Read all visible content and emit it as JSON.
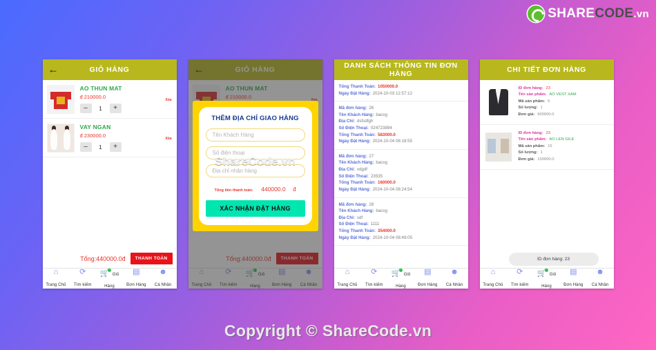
{
  "brand": {
    "part1": "SHARE",
    "part2": "CODE",
    "part3": ".vn",
    "logo_icon": "recycle-leaf-icon"
  },
  "footer": {
    "copyright": "Copyright © ShareCode.vn"
  },
  "watermark": {
    "text": "ShareCode.vn"
  },
  "nav": {
    "items": [
      {
        "label": "Trang Chủ",
        "icon": "home-icon"
      },
      {
        "label": "Tìm kiếm",
        "icon": "search-icon"
      },
      {
        "label": "Giỏ Hàng",
        "icon": "cart-icon"
      },
      {
        "label": "Đơn Hàng",
        "icon": "clipboard-icon"
      },
      {
        "label": "Cá Nhân",
        "icon": "person-icon"
      }
    ],
    "items_alt": [
      {
        "label": "Trang Chủ",
        "icon": "home-icon"
      },
      {
        "label": "Tìm kiếm",
        "icon": "search-icon"
      },
      {
        "label": "Giỏ Hàng",
        "icon": "cart-icon"
      },
      {
        "label": "Đơn Hàng",
        "icon": "clipboard-icon"
      },
      {
        "label": "Cá Nhân",
        "icon": "person-icon"
      }
    ]
  },
  "panel1": {
    "title": "GIỎ HÀNG",
    "back_icon": "arrow-left-icon",
    "items": [
      {
        "name": "AO THUN MAT",
        "price": "đ 210000.0",
        "qty": "1",
        "minus": "–",
        "plus": "+",
        "delete": "Xóa",
        "thumb": "red-tshirt-image"
      },
      {
        "name": "VAY NGAN",
        "price": "đ 230000.0",
        "qty": "1",
        "minus": "–",
        "plus": "+",
        "delete": "Xóa",
        "thumb": "white-dress-image"
      }
    ],
    "total": "Tổng:440000.0đ",
    "pay_button": "THANH TOÁN"
  },
  "panel2": {
    "title": "GIỎ HÀNG",
    "back_icon": "arrow-left-icon",
    "items": [
      {
        "name": "AO THUN MAT",
        "price": "đ 210000.0",
        "delete": "Xóa",
        "thumb": "red-tshirt-image"
      }
    ],
    "total": "Tổng:440000.0đ",
    "pay_button": "THANH TOÁN",
    "dialog": {
      "title": "THÊM ĐỊA CHỈ GIAO HÀNG",
      "fields": [
        {
          "placeholder": "Tên Khách Hàng",
          "value": ""
        },
        {
          "placeholder": "Số điện thoại",
          "value": ""
        },
        {
          "placeholder": "Địa chỉ nhận hàng",
          "value": ""
        }
      ],
      "sum_label": "Tổng tiền thanh toán:",
      "sum_value": "440000.0",
      "sum_currency": "đ",
      "confirm_button": "XÁC NHẬN ĐẶT HÀNG"
    }
  },
  "panel3": {
    "title": "DANH SÁCH THÔNG TIN ĐƠN HÀNG",
    "labels": {
      "ma": "Mã đơn hàng:",
      "ten": "Tên Khách Hàng:",
      "diachi": "Địa Chỉ:",
      "sdt": "Số Điện Thoại:",
      "tong": "Tổng Thanh Toán:",
      "ngay": "Ngày Đặt Hàng:"
    },
    "orders": [
      {
        "ma": "",
        "ten": "",
        "diachi": "",
        "sdt": "",
        "tong": "1050000.0",
        "ngay": "2024-10-03 12:57:12"
      },
      {
        "ma": "26",
        "ten": "bacxg",
        "diachi": "dsfsdfgh",
        "sdt": "024723894",
        "tong": "583000.0",
        "ngay": "2024-10-04 08:18:55"
      },
      {
        "ma": "27",
        "ten": "bacxg",
        "diachi": "vdgdf",
        "sdt": "23535",
        "tong": "160000.0",
        "ngay": "2024-10-04 08:24:54"
      },
      {
        "ma": "28",
        "ten": "bacxg",
        "diachi": "sdf",
        "sdt": "1111",
        "tong": "354000.0",
        "ngay": "2024-10-04 08:49:05"
      }
    ]
  },
  "panel4": {
    "title": "CHI TIẾT ĐƠN HÀNG",
    "labels": {
      "id": "ID đơn hàng:",
      "ten": "Tên sản phẩm:",
      "ma": "Mã sản phẩm:",
      "sl": "Số lượng:",
      "gia": "Đơn giá:"
    },
    "items": [
      {
        "id": "23",
        "ten": "AO VEST XAM",
        "ma": "5",
        "sl": "1",
        "gia": "900000.0",
        "thumb": "grey-vest-image"
      },
      {
        "id": "23",
        "ten": "AO LEN GILE",
        "ma": "15",
        "sl": "1",
        "gia": "150000.0",
        "thumb": "knit-vest-image"
      }
    ],
    "toast": "ID đơn hàng: 23"
  },
  "colors": {
    "header": "#b8b81e",
    "pay_red": "#e8131a",
    "accent_green": "#2fa84f",
    "price_red": "#e8332a",
    "dialog_yellow": "#ffd400",
    "confirm_teal": "#00e6b0",
    "label_blue": "#5a6fd8",
    "label_pink": "#e0359a"
  }
}
